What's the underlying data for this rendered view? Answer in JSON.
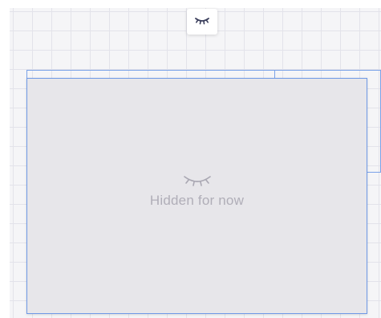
{
  "hidden_card": {
    "message": "Hidden for now",
    "icon": "closed-eye-icon"
  },
  "toolbar": {
    "toggle_icon": "closed-eye-icon"
  },
  "colors": {
    "selection_outline": "#6f99e6",
    "card_background": "#e7e6ea",
    "message_text": "#b0aeb8",
    "icon_dark": "#3b3f5c"
  }
}
